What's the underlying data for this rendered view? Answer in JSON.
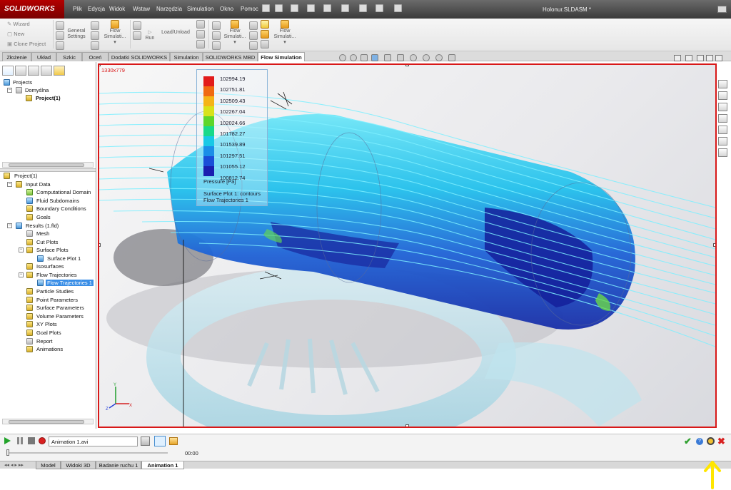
{
  "app": {
    "logo": "SOLIDWORKS",
    "document_title": "Holonur.SLDASM *",
    "menu": [
      "Plik",
      "Edycja",
      "Widok",
      "Wstaw",
      "Narzędzia",
      "Simulation",
      "Okno",
      "Pomoc"
    ]
  },
  "command_manager": {
    "wizard": "Wizard",
    "new": "New",
    "clone_project": "Clone Project",
    "general_settings_1": "General",
    "general_settings_2": "Settings",
    "flow_sim_1": "Flow",
    "flow_sim_2": "Simulati...",
    "run": "Run",
    "load_unload": "Load/Unload",
    "flow_sim_b1": "Flow",
    "flow_sim_b2": "Simulati...",
    "flow_sim_c1": "Flow",
    "flow_sim_c2": "Simulati..."
  },
  "tabs": [
    "Złożenie",
    "Układ",
    "Szkic",
    "Oceń",
    "Dodatki SOLIDWORKS",
    "Simulation",
    "SOLIDWORKS MBD",
    "Flow Simulation"
  ],
  "projects_tree": {
    "root": "Projects",
    "config": "Domyślna",
    "project": "Project(1)"
  },
  "analysis_tree": {
    "root": "Project(1)",
    "items": [
      "Input Data",
      "Computational Domain",
      "Fluid Subdomains",
      "Boundary Conditions",
      "Goals",
      "Results (1.fld)",
      "Mesh",
      "Cut Plots",
      "Surface Plots",
      "Surface Plot 1",
      "Isosurfaces",
      "Flow Trajectories",
      "Flow Trajectories 1",
      "Particle Studies",
      "Point Parameters",
      "Surface Parameters",
      "Volume Parameters",
      "XY Plots",
      "Goal Plots",
      "Report",
      "Animations"
    ]
  },
  "viewport": {
    "resolution_label": "1330x779",
    "legend": {
      "values": [
        "102994.19",
        "102751.81",
        "102509.43",
        "102267.04",
        "102024.66",
        "101782.27",
        "101539.89",
        "101297.51",
        "101055.12",
        "100812.74"
      ],
      "colors": [
        "#e21b1b",
        "#f06a12",
        "#f5b418",
        "#d8e21a",
        "#5ed62a",
        "#19d98a",
        "#18c9e6",
        "#1a8fe8",
        "#1a4fd8",
        "#1a1fb0"
      ],
      "unit_label": "Pressure [Pa]",
      "caption_1": "Surface Plot 1: contours",
      "caption_2": "Flow Trajectories 1"
    }
  },
  "animation": {
    "file": "Animation 1.avi",
    "time": "00:00"
  },
  "bottom_tabs": [
    "Model",
    "Widoki 3D",
    "Badanie ruchu 1",
    "Animation 1"
  ]
}
